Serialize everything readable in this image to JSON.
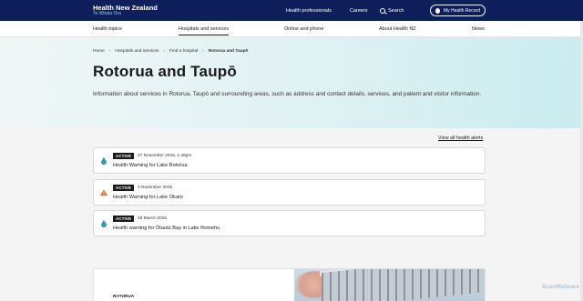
{
  "header": {
    "logo_title": "Health New Zealand",
    "logo_subtitle": "Te Whatu Ora",
    "links": [
      "Health professionals",
      "Careers"
    ],
    "search_label": "Search",
    "account_button": "My Health Record"
  },
  "nav": {
    "items": [
      "Health topics",
      "Hospitals and services",
      "Online and phone",
      "About Health NZ",
      "News"
    ],
    "active_index": 1
  },
  "breadcrumb": [
    "Home",
    "Hospitals and services",
    "Find a hospital",
    "Rotorua and Taupō"
  ],
  "page": {
    "title": "Rotorua and Taupō",
    "intro": "Information about services in Rotorua, Taupō and surrounding areas, such as address and contact details, services, and patient and visitor information."
  },
  "alerts": {
    "view_all_label": "View all health alerts",
    "items": [
      {
        "status": "ACTIVE",
        "date": "27 November 2025, 1:46pm",
        "title": "Health Warning for Lake Rotorua",
        "icon": "water-drop-icon"
      },
      {
        "status": "ACTIVE",
        "date": "3 November 2025",
        "title": "Health Warning for Lake Okaro",
        "icon": "warning-triangle-icon"
      },
      {
        "status": "ACTIVE",
        "date": "26 March 2025",
        "title": "Health warning for Ōtautū Bay in Lake Rotoehu",
        "icon": "water-drop-icon"
      }
    ]
  },
  "card": {
    "label": "ROTORUA"
  },
  "watermark": "ScanMalware",
  "colors": {
    "header_bg": "#0f1f5c",
    "accent_teal": "#2a9fb0",
    "warning_orange": "#e0703a"
  }
}
